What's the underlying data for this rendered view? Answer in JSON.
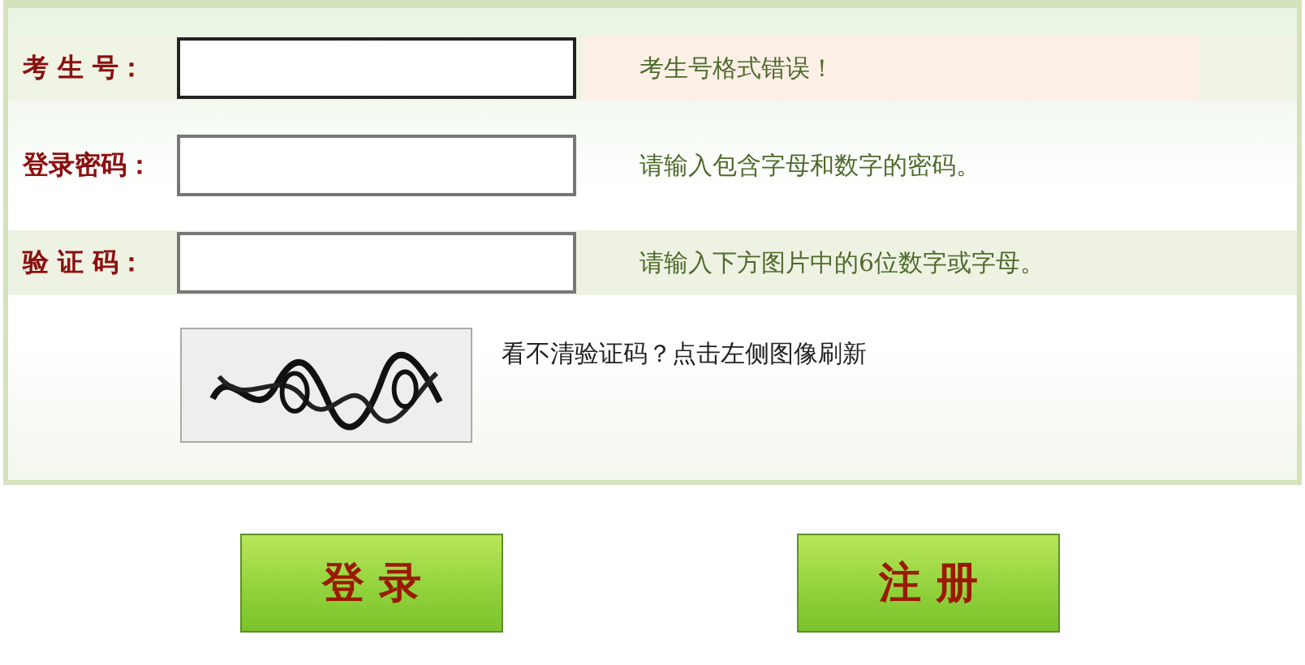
{
  "fields": [
    {
      "label": "考 生 号：",
      "focused": true,
      "hint": "考生号格式错误！",
      "error": true
    },
    {
      "label": "登录密码：",
      "focused": false,
      "hint": "请输入包含字母和数字的密码。",
      "error": false
    },
    {
      "label": "验 证 码：",
      "focused": false,
      "hint": "请输入下方图片中的6位数字或字母。",
      "error": false
    }
  ],
  "captcha": {
    "kind": "picture",
    "note": "看不清验证码？点击左侧图像刷新"
  },
  "buttons": [
    "登 录",
    "注 册"
  ]
}
